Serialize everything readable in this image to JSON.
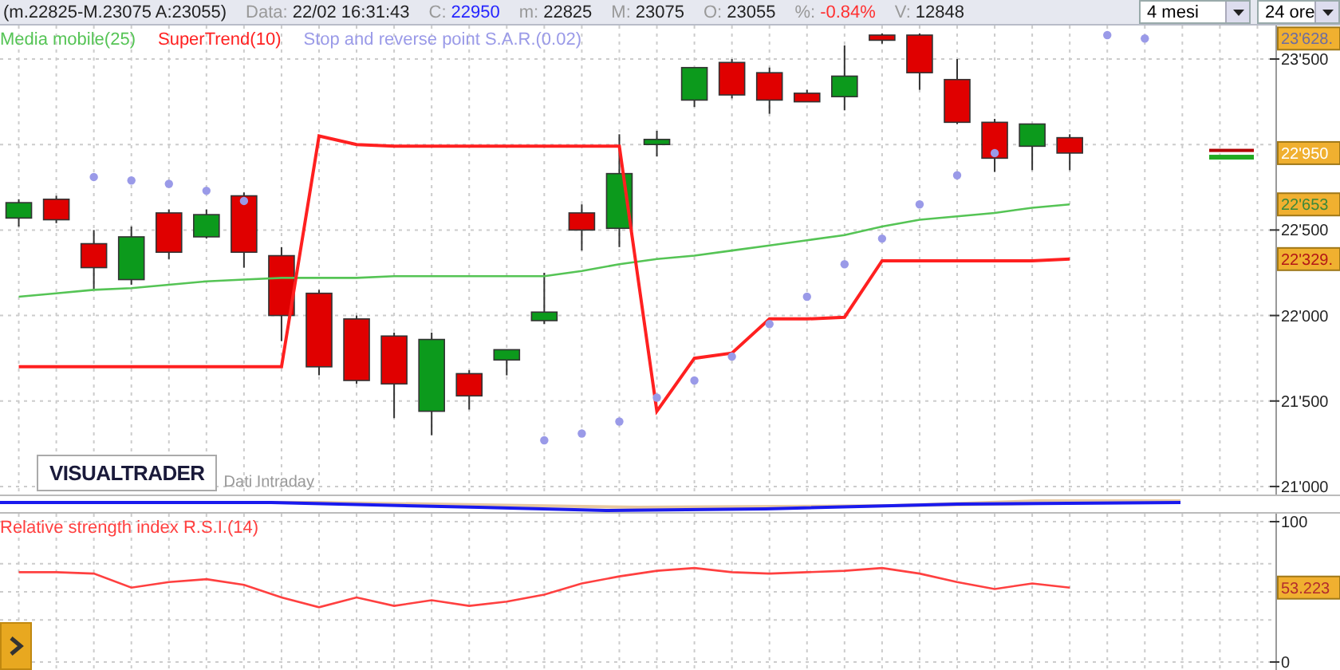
{
  "toolbar": {
    "range": "(m.22825-M.23075 A:23055)",
    "fields": [
      {
        "label": "Data:",
        "value": "22/02 16:31:43",
        "kind": "plain"
      },
      {
        "label": "C:",
        "value": "22950",
        "kind": "close"
      },
      {
        "label": "m:",
        "value": "22825",
        "kind": "plain"
      },
      {
        "label": "M:",
        "value": "23075",
        "kind": "plain"
      },
      {
        "label": "O:",
        "value": "23055",
        "kind": "plain"
      },
      {
        "label": "%:",
        "value": "-0.84%",
        "kind": "change"
      },
      {
        "label": "V:",
        "value": "12848",
        "kind": "plain"
      }
    ],
    "dropdowns": [
      {
        "value": "4 mesi"
      },
      {
        "value": "24 ore"
      }
    ]
  },
  "price_panel": {
    "logo": "VISUALTRADER",
    "source": "Dati Intraday",
    "chart_data": {
      "type": "candlestick",
      "grid": true,
      "categories": [
        null,
        null,
        null,
        null,
        null,
        null,
        null,
        null,
        null,
        null,
        null,
        null,
        null,
        null,
        null,
        null,
        null,
        null,
        null,
        null,
        null,
        null,
        null,
        null,
        null,
        null,
        null,
        null,
        null,
        null,
        null,
        null,
        null,
        null
      ],
      "ylim": [
        20953,
        23696
      ],
      "yticks": [
        {
          "value": 23500,
          "label": "23'500"
        },
        {
          "value": 22500,
          "label": "22'500"
        },
        {
          "value": 22000,
          "label": "22'000"
        },
        {
          "value": 21500,
          "label": "21'500"
        },
        {
          "value": 21000,
          "label": "21'000"
        }
      ],
      "ohlc": [
        [
          22570,
          22680,
          22520,
          22660
        ],
        [
          22680,
          22700,
          22540,
          22560
        ],
        [
          22420,
          22500,
          22150,
          22280
        ],
        [
          22210,
          22520,
          22180,
          22460
        ],
        [
          22600,
          22620,
          22330,
          22370
        ],
        [
          22460,
          22620,
          22450,
          22590
        ],
        [
          22700,
          22720,
          22280,
          22370
        ],
        [
          22350,
          22400,
          21850,
          22000
        ],
        [
          22130,
          22150,
          21650,
          21700
        ],
        [
          21980,
          22000,
          21600,
          21620
        ],
        [
          21880,
          21900,
          21400,
          21600
        ],
        [
          21440,
          21900,
          21300,
          21860
        ],
        [
          21660,
          21680,
          21450,
          21530
        ],
        [
          21740,
          21800,
          21650,
          21800
        ],
        [
          21970,
          22250,
          21950,
          22020
        ],
        [
          22600,
          22650,
          22380,
          22500
        ],
        [
          22510,
          23060,
          22400,
          22830
        ],
        [
          23000,
          23080,
          22930,
          23030
        ],
        [
          23260,
          23450,
          23220,
          23450
        ],
        [
          23480,
          23500,
          23270,
          23290
        ],
        [
          23420,
          23450,
          23180,
          23260
        ],
        [
          23300,
          23320,
          23250,
          23250
        ],
        [
          23280,
          23580,
          23200,
          23400
        ],
        [
          23640,
          23650,
          23590,
          23610
        ],
        [
          23640,
          23650,
          23320,
          23420
        ],
        [
          23380,
          23500,
          23120,
          23130
        ],
        [
          23130,
          23150,
          22840,
          22920
        ],
        [
          22990,
          23120,
          22850,
          23120
        ],
        [
          23040,
          23060,
          22850,
          22950
        ],
        null,
        null,
        null,
        null,
        null
      ],
      "series": [
        {
          "name": "Media mobile(25)",
          "type": "line",
          "color": "#55c455",
          "values": [
            22110,
            22130,
            22150,
            22160,
            22180,
            22200,
            22210,
            22220,
            22220,
            22220,
            22230,
            22230,
            22230,
            22230,
            22230,
            22260,
            22300,
            22330,
            22350,
            22380,
            22410,
            22440,
            22470,
            22520,
            22560,
            22580,
            22600,
            22630,
            22650,
            null,
            null,
            null,
            null,
            null
          ]
        },
        {
          "name": "SuperTrend(10)",
          "type": "line",
          "color": "#ff2020",
          "values": [
            21700,
            21700,
            21700,
            21700,
            21700,
            21700,
            21700,
            21700,
            23050,
            23000,
            22990,
            22990,
            22990,
            22990,
            22990,
            22990,
            22990,
            21440,
            21750,
            21780,
            21980,
            21980,
            21990,
            22320,
            22320,
            22320,
            22320,
            22320,
            22330,
            null,
            null,
            null,
            null,
            null
          ]
        },
        {
          "name": "Stop and reverse point S.A.R.(0.02)",
          "type": "scatter",
          "color": "#9a9ae8",
          "values": [
            null,
            null,
            22810,
            22790,
            22770,
            22730,
            22670,
            null,
            null,
            null,
            null,
            null,
            null,
            null,
            21270,
            21310,
            21380,
            21520,
            21620,
            21760,
            21950,
            22110,
            22300,
            22450,
            22650,
            22820,
            22950,
            null,
            null,
            23640,
            23620,
            null,
            null,
            null
          ]
        }
      ],
      "annotations": [
        "23'628.",
        "22'950",
        "22'653",
        "22'329."
      ]
    }
  },
  "rsi_panel": {
    "chart_data": {
      "type": "line",
      "grid": true,
      "title": "Relative strength index R.S.I.(14)",
      "categories": [
        null,
        null,
        null,
        null,
        null,
        null,
        null,
        null,
        null,
        null,
        null,
        null,
        null,
        null,
        null,
        null,
        null,
        null,
        null,
        null,
        null,
        null,
        null,
        null,
        null,
        null,
        null,
        null,
        null,
        null,
        null,
        null,
        null,
        null
      ],
      "ylim": [
        -5.7,
        105.7
      ],
      "yticks": [
        {
          "value": 100,
          "label": "100"
        },
        {
          "value": 0,
          "label": "0"
        }
      ],
      "series": [
        {
          "type": "line",
          "color": "#ff4040",
          "values": [
            64,
            64,
            63,
            53,
            57,
            59,
            55,
            46,
            39,
            46,
            40,
            44,
            40,
            43,
            48,
            56,
            61,
            65,
            67,
            64,
            63,
            64,
            65,
            67,
            63,
            57,
            52,
            56,
            53,
            null,
            null,
            null,
            null,
            null
          ]
        }
      ],
      "annotations": [
        "53.223"
      ]
    }
  }
}
